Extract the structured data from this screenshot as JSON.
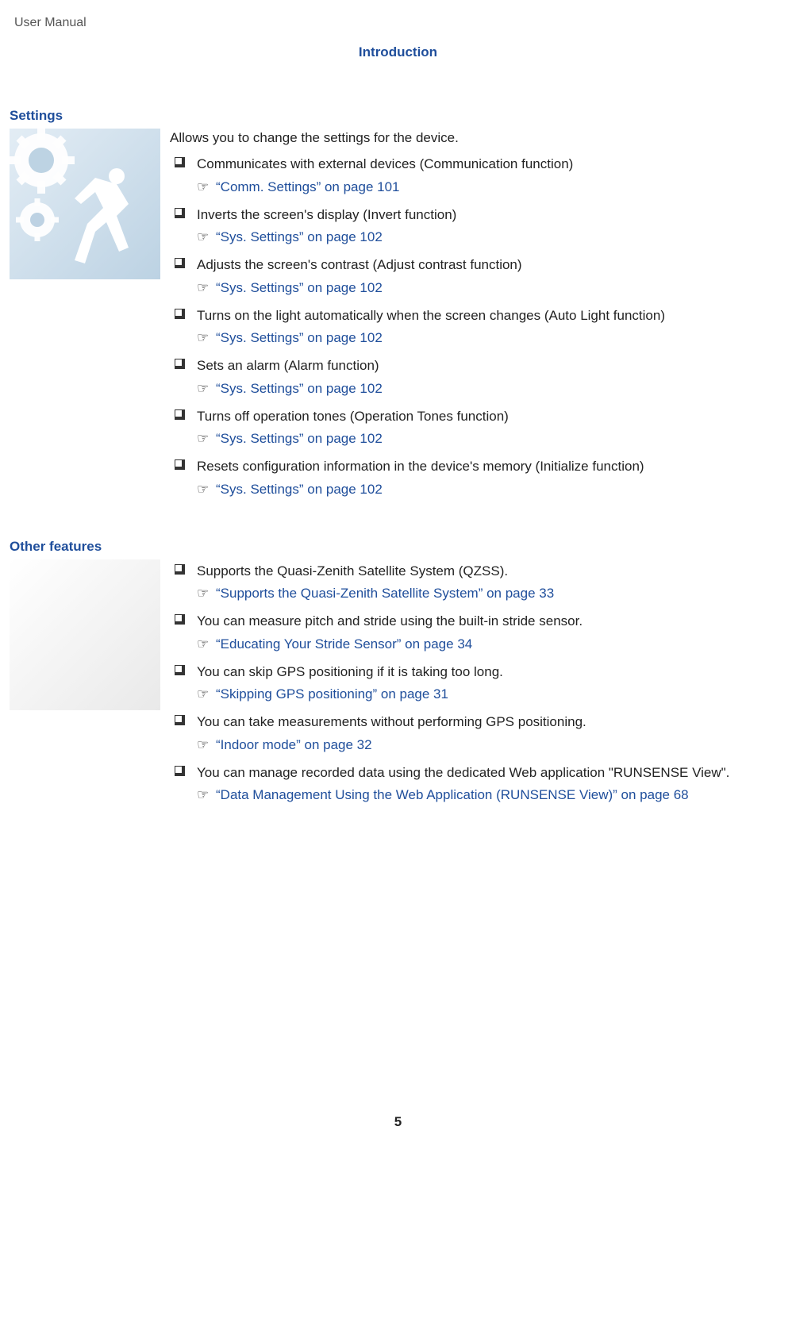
{
  "running_head": "User Manual",
  "chapter_title": "Introduction",
  "page_number": "5",
  "sections": {
    "settings": {
      "title": "Settings",
      "lead": "Allows you to change the settings for the device.",
      "items": [
        {
          "text": "Communicates with external devices (Communication function)",
          "xref": "“Comm. Settings” on page 101"
        },
        {
          "text": "Inverts the screen's display (Invert function)",
          "xref": "“Sys. Settings” on page 102"
        },
        {
          "text": "Adjusts the screen's contrast (Adjust contrast function)",
          "xref": "“Sys. Settings” on page 102"
        },
        {
          "text": "Turns on the light automatically when the screen changes (Auto Light function)",
          "xref": "“Sys. Settings” on page 102"
        },
        {
          "text": "Sets an alarm (Alarm function)",
          "xref": "“Sys. Settings” on page 102"
        },
        {
          "text": "Turns off operation tones (Operation Tones function)",
          "xref": "“Sys. Settings” on page 102"
        },
        {
          "text": "Resets configuration information in the device's memory (Initialize function)",
          "xref": "“Sys. Settings” on page 102"
        }
      ]
    },
    "other": {
      "title": "Other features",
      "items": [
        {
          "text": "Supports the Quasi-Zenith Satellite System (QZSS).",
          "xref": "“Supports the Quasi-Zenith Satellite System” on page 33"
        },
        {
          "text": "You can measure pitch and stride using the built-in stride sensor.",
          "xref": "“Educating Your Stride Sensor” on page 34"
        },
        {
          "text": "You can skip GPS positioning if it is taking too long.",
          "xref": "“Skipping GPS positioning” on page 31"
        },
        {
          "text": "You can take measurements without performing GPS positioning.",
          "xref": "“Indoor mode” on page 32"
        },
        {
          "text": "You can manage recorded data using the dedicated Web application \"RUNSENSE View\".",
          "xref": "“Data Management Using the Web Application (RUNSENSE View)” on page 68"
        }
      ]
    }
  }
}
